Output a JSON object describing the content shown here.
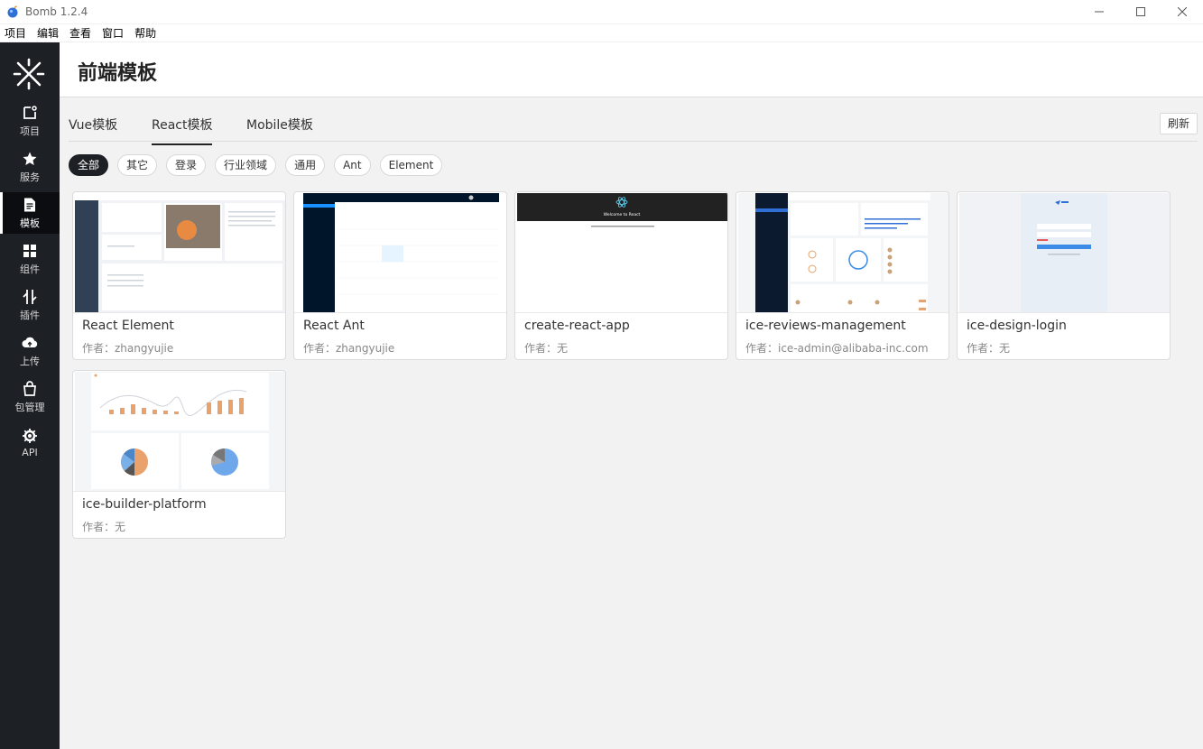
{
  "window": {
    "title": "Bomb 1.2.4"
  },
  "menu": [
    "项目",
    "编辑",
    "查看",
    "窗口",
    "帮助"
  ],
  "sidebar": {
    "items": [
      {
        "label": "项目",
        "icon": "project-icon"
      },
      {
        "label": "服务",
        "icon": "star-icon"
      },
      {
        "label": "模板",
        "icon": "document-icon",
        "active": true
      },
      {
        "label": "组件",
        "icon": "grid-icon"
      },
      {
        "label": "插件",
        "icon": "plugin-icon"
      },
      {
        "label": "上传",
        "icon": "cloud-upload-icon"
      },
      {
        "label": "包管理",
        "icon": "package-icon"
      },
      {
        "label": "API",
        "icon": "api-icon"
      }
    ]
  },
  "header": {
    "title": "前端模板"
  },
  "tabs": {
    "items": [
      "Vue模板",
      "React模板",
      "Mobile模板"
    ],
    "active": "React模板",
    "refresh_label": "刷新"
  },
  "filters": {
    "items": [
      "全部",
      "其它",
      "登录",
      "行业领域",
      "通用",
      "Ant",
      "Element"
    ],
    "active": "全部"
  },
  "templates": [
    {
      "title": "React Element",
      "author": "作者：zhangyujie"
    },
    {
      "title": "React Ant",
      "author": "作者：zhangyujie"
    },
    {
      "title": "create-react-app",
      "author": "作者：无",
      "thumb_text": "Welcome to React"
    },
    {
      "title": "ice-reviews-management",
      "author": "作者：ice-admin@alibaba-inc.com"
    },
    {
      "title": "ice-design-login",
      "author": "作者：无"
    },
    {
      "title": "ice-builder-platform",
      "author": "作者：无"
    }
  ],
  "colors": {
    "sidebar": "#1d2126",
    "accent_orange": "#e9a26b",
    "accent_blue": "#3b8be7"
  }
}
